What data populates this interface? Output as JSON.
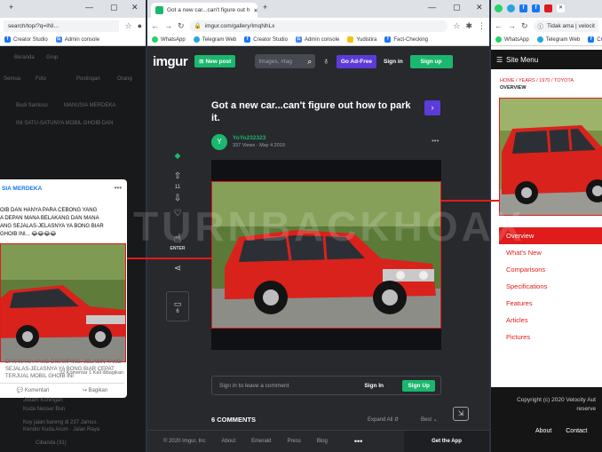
{
  "colors": {
    "accent_red": "#e01b1b",
    "imgur_green": "#1bb76e",
    "imgur_purple": "#5c3bd9",
    "fb_blue": "#1877f2"
  },
  "left_window": {
    "url": "search/top/?q=INI...",
    "bookmarks": [
      "Creator Studio",
      "Admin console"
    ],
    "bg_labels": [
      "Beranda",
      "Grup",
      "Semua",
      "Foto",
      "Postingan",
      "Orang"
    ],
    "bg_post_author": "Budi Santoso",
    "bg_post_group": "MANUSIA MERDEKA",
    "bg_caption": "INI SATU-SATUNYA MOBIL GHOIB DAN",
    "post": {
      "group": "SIA MERDEKA",
      "text": "OIB DAN HANYA PARA CEBONG YANG\nA DEPAN MANA BELAKANG DAN MANA\nANG SEJALAS-JELASNYA YA BONG BIAR\nGHOIB INI... 😂😂😂😂",
      "stats": "32 Komentar  1 Kali dibagikan",
      "actions": [
        "Komentari",
        "Bagikan"
      ]
    },
    "bg_below": "DAN MANA YANG DISAMPING. JELASIN YANG\nSEJALAS-JELASNYA YA BONG BIAR CEPAT\nTERJUAL MOBIL GHOIB INI",
    "bg_name": "Jokam Kuningan",
    "bg_group2": "Kuda Nesser Bun",
    "bg_small": "Kuy jalan bareng di 237 Jamus.\nKendor Kuda Arum · Jalan Raya",
    "bg_foot": "Cibanda (31)"
  },
  "center_window": {
    "tab_title": "Got a new car...can't figure out h",
    "url": "imgur.com/gallery/ImqNhLx",
    "bookmarks": [
      "WhatsApp",
      "Telegram Web",
      "Creator Studio",
      "Admin console",
      "Yudistira",
      "Fact-Checking"
    ],
    "header": {
      "logo": "imgur",
      "new_post": "New post",
      "search_placeholder": "Images, #tag",
      "ad_free": "Go Ad-Free",
      "sign_in": "Sign in",
      "sign_up": "Sign up"
    },
    "post": {
      "title": "Got a new car...can't figure out how to park it.",
      "author": "YoYo232323",
      "views": "337 Views",
      "date": "May 4 2019",
      "vote_count": "11",
      "comment_count": "6",
      "emerald_label": "ENTER",
      "next_icon": "›",
      "avatar_letter": "Y"
    },
    "comment_box": {
      "placeholder": "Sign in to leave a comment",
      "sign_in": "Sign In",
      "sign_up": "Sign Up"
    },
    "comments": {
      "heading": "6 COMMENTS",
      "expand": "Expand All",
      "sort": "Best"
    },
    "footer": {
      "copyright": "© 2020 Imgur, Inc",
      "links": [
        "About",
        "Emerald",
        "Press",
        "Blog"
      ],
      "get_app": "Get the App"
    }
  },
  "right_window": {
    "url": "Tidak ama  |  velocit",
    "bookmarks": [
      "WhatsApp",
      "Telegram Web",
      "Cr"
    ],
    "site_menu": "Site Menu",
    "breadcrumb": "HOME  /  YEARS  /  1970  /  TOYOTA",
    "breadcrumb_current": "OVERVIEW",
    "menu": [
      "Overview",
      "What's New",
      "Comparisons",
      "Specifications",
      "Features",
      "Articles",
      "Pictures"
    ],
    "footer_copy": "Copyright (c) 2020 Velocity Aut\nreserve",
    "footer_links": [
      "About",
      "Contact"
    ]
  },
  "watermark": "TURNBACKHOAX"
}
